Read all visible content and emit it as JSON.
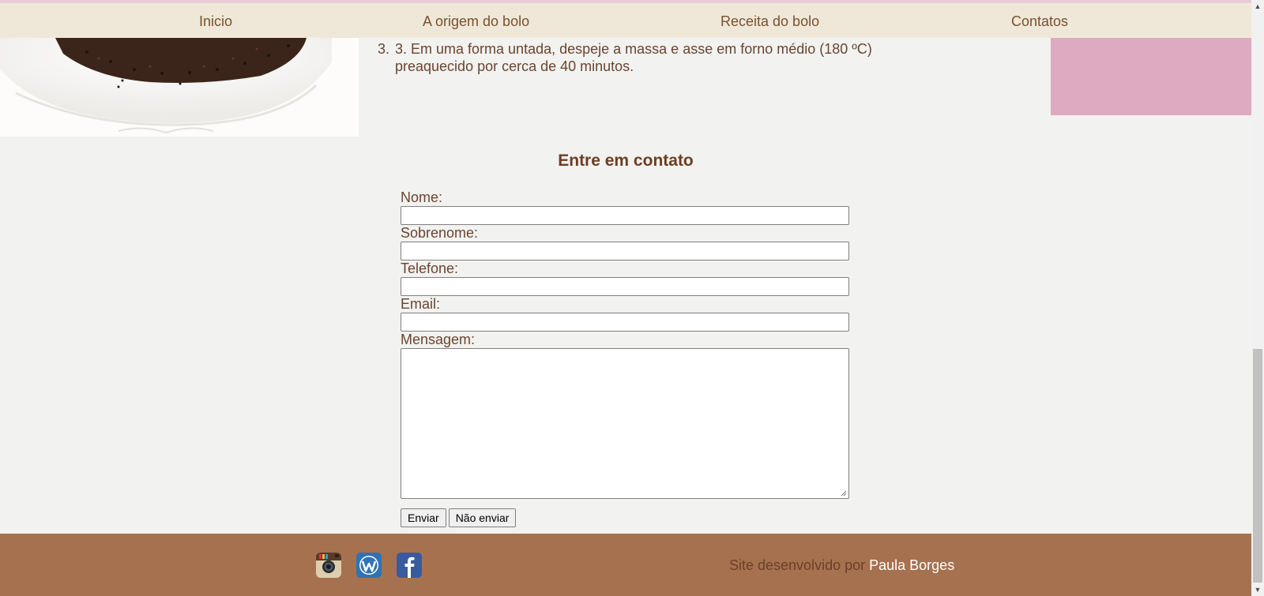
{
  "nav": {
    "items": [
      "Inicio",
      "A origem do bolo",
      "Receita do bolo",
      "Contatos"
    ]
  },
  "recipe": {
    "step_number": "3.",
    "step_text": "3. Em uma forma untada, despeje a massa e asse em forno médio (180 ºC) preaquecido por cerca de 40 minutos."
  },
  "contact": {
    "title": "Entre em contato",
    "fields": {
      "nome": "Nome:",
      "sobrenome": "Sobrenome:",
      "telefone": "Telefone:",
      "email": "Email:",
      "mensagem": "Mensagem:"
    },
    "buttons": {
      "submit": "Enviar",
      "reset": "Não enviar"
    }
  },
  "footer": {
    "credit_prefix": "Site desenvolvido por",
    "credit_author": "Paula Borges",
    "social_icons": [
      "instagram-icon",
      "wordpress-icon",
      "facebook-icon"
    ]
  },
  "colors": {
    "nav_bg": "#efe8d8",
    "page_bg": "#f2f2f0",
    "accent_pink": "#ddaac1",
    "footer_bg": "#a6714f",
    "title_brown": "#6b3f22"
  }
}
